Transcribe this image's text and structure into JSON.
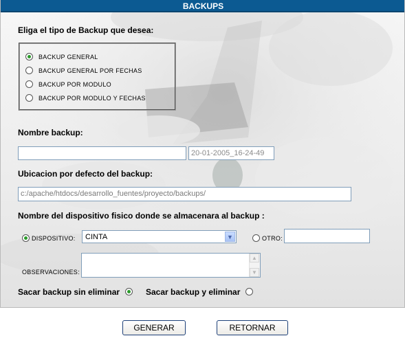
{
  "title": "BACKUPS",
  "backup_type": {
    "prompt": "Eliga el tipo de Backup que desea:",
    "options": [
      {
        "label": "BACKUP GENERAL",
        "selected": true
      },
      {
        "label": "BACKUP GENERAL POR FECHAS",
        "selected": false
      },
      {
        "label": "BACKUP POR MODULO",
        "selected": false
      },
      {
        "label": "BACKUP POR MODULO Y FECHAS",
        "selected": false
      }
    ]
  },
  "nombre": {
    "label": "Nombre backup:",
    "value": "",
    "date_value": "20-01-2005_16-24-49"
  },
  "ubicacion": {
    "label": "Ubicacion por defecto del backup:",
    "value": "c:/apache/htdocs/desarrollo_fuentes/proyecto/backups/"
  },
  "dispositivo": {
    "label": "Nombre del dispositivo fisico donde se almacenara al backup :",
    "dispositivo_label": "DISPOSITIVO:",
    "dispositivo_selected": true,
    "dispositivo_value": "CINTA",
    "otro_label": "OTRO:",
    "otro_selected": false,
    "otro_value": ""
  },
  "observaciones": {
    "label": "OBSERVACIONES:",
    "value": ""
  },
  "eliminar": {
    "sin_label": "Sacar backup sin eliminar",
    "sin_selected": true,
    "con_label": "Sacar backup y eliminar",
    "con_selected": false
  },
  "buttons": {
    "generar": "GENERAR",
    "retornar": "RETORNAR"
  },
  "colors": {
    "titlebar": "#0c5a92",
    "radio_dot": "#2a9a2a",
    "input_border": "#7f9db9"
  }
}
